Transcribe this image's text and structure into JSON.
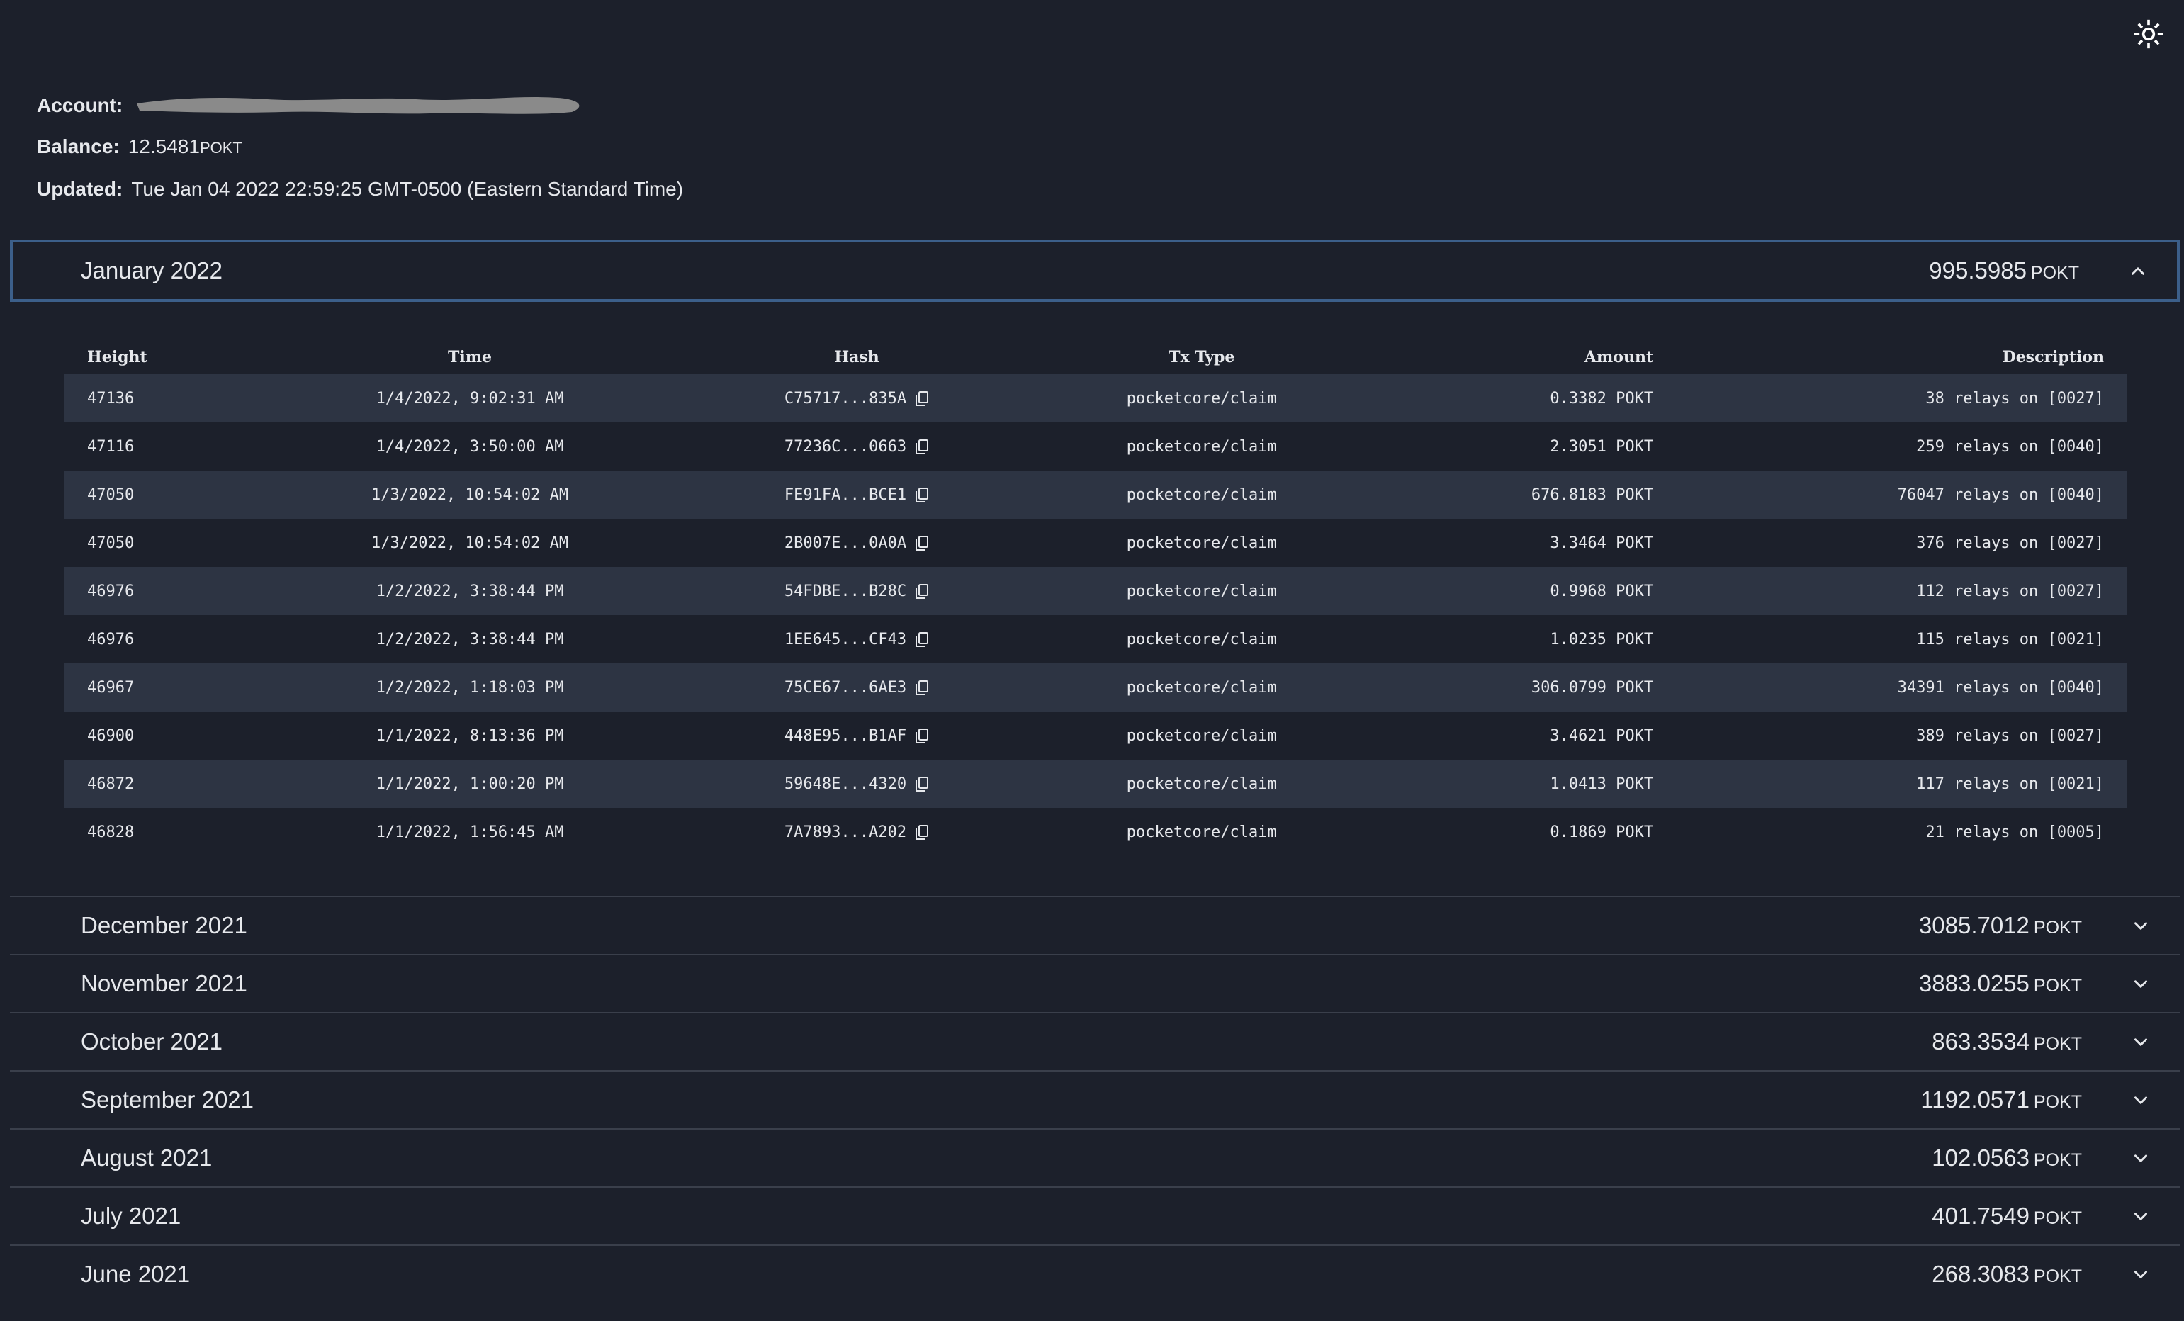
{
  "header": {
    "theme_toggle_icon": "sun-icon"
  },
  "account": {
    "account_label": "Account:",
    "balance_label": "Balance:",
    "balance_value": "12.5481",
    "balance_unit": "POKT",
    "updated_label": "Updated:",
    "updated_value": "Tue Jan 04 2022 22:59:25 GMT-0500 (Eastern Standard Time)"
  },
  "expanded_month": {
    "title": "January 2022",
    "total": "995.5985",
    "unit": "POKT",
    "columns": [
      "Height",
      "Time",
      "Hash",
      "Tx Type",
      "Amount",
      "Description"
    ],
    "rows": [
      {
        "height": "47136",
        "time": "1/4/2022, 9:02:31 AM",
        "hash": "C75717...835A",
        "type": "pocketcore/claim",
        "amount": "0.3382 POKT",
        "description": "38 relays on [0027]"
      },
      {
        "height": "47116",
        "time": "1/4/2022, 3:50:00 AM",
        "hash": "77236C...0663",
        "type": "pocketcore/claim",
        "amount": "2.3051 POKT",
        "description": "259 relays on [0040]"
      },
      {
        "height": "47050",
        "time": "1/3/2022, 10:54:02 AM",
        "hash": "FE91FA...BCE1",
        "type": "pocketcore/claim",
        "amount": "676.8183 POKT",
        "description": "76047 relays on [0040]"
      },
      {
        "height": "47050",
        "time": "1/3/2022, 10:54:02 AM",
        "hash": "2B007E...0A0A",
        "type": "pocketcore/claim",
        "amount": "3.3464 POKT",
        "description": "376 relays on [0027]"
      },
      {
        "height": "46976",
        "time": "1/2/2022, 3:38:44 PM",
        "hash": "54FDBE...B28C",
        "type": "pocketcore/claim",
        "amount": "0.9968 POKT",
        "description": "112 relays on [0027]"
      },
      {
        "height": "46976",
        "time": "1/2/2022, 3:38:44 PM",
        "hash": "1EE645...CF43",
        "type": "pocketcore/claim",
        "amount": "1.0235 POKT",
        "description": "115 relays on [0021]"
      },
      {
        "height": "46967",
        "time": "1/2/2022, 1:18:03 PM",
        "hash": "75CE67...6AE3",
        "type": "pocketcore/claim",
        "amount": "306.0799 POKT",
        "description": "34391 relays on [0040]"
      },
      {
        "height": "46900",
        "time": "1/1/2022, 8:13:36 PM",
        "hash": "448E95...B1AF",
        "type": "pocketcore/claim",
        "amount": "3.4621 POKT",
        "description": "389 relays on [0027]"
      },
      {
        "height": "46872",
        "time": "1/1/2022, 1:00:20 PM",
        "hash": "59648E...4320",
        "type": "pocketcore/claim",
        "amount": "1.0413 POKT",
        "description": "117 relays on [0021]"
      },
      {
        "height": "46828",
        "time": "1/1/2022, 1:56:45 AM",
        "hash": "7A7893...A202",
        "type": "pocketcore/claim",
        "amount": "0.1869 POKT",
        "description": "21 relays on [0005]"
      }
    ]
  },
  "collapsed_months": [
    {
      "title": "December 2021",
      "total": "3085.7012",
      "unit": "POKT"
    },
    {
      "title": "November 2021",
      "total": "3883.0255",
      "unit": "POKT"
    },
    {
      "title": "October 2021",
      "total": "863.3534",
      "unit": "POKT"
    },
    {
      "title": "September 2021",
      "total": "1192.0571",
      "unit": "POKT"
    },
    {
      "title": "August 2021",
      "total": "102.0563",
      "unit": "POKT"
    },
    {
      "title": "July 2021",
      "total": "401.7549",
      "unit": "POKT"
    },
    {
      "title": "June 2021",
      "total": "268.3083",
      "unit": "POKT"
    }
  ],
  "colors": {
    "background": "#1c202b",
    "stripe": "#2d3443",
    "accent_border": "#3c5f8a",
    "divider": "#3a3f4b",
    "text": "#e6e8ec",
    "redaction": "#8a8a8a"
  }
}
